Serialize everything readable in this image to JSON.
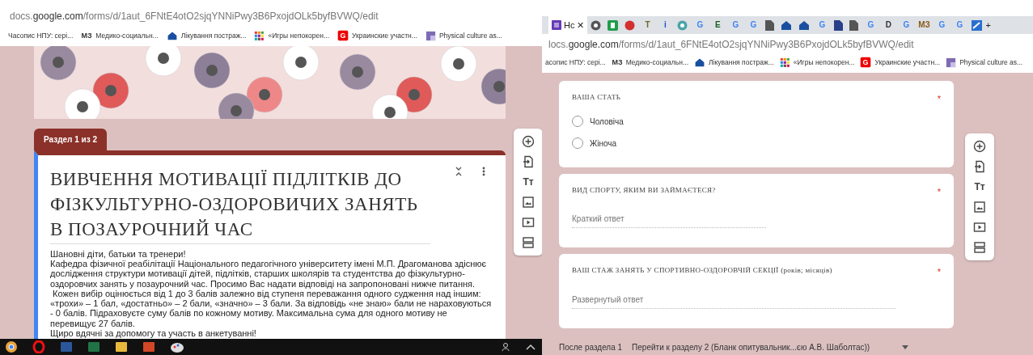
{
  "left_window": {
    "address": {
      "host_prefix": "docs.",
      "host": "google.com",
      "path": "/forms/d/1aut_6FNtE4otO2sjqYNNiPwy3B6PxojdOLk5byfBVWQ/edit"
    },
    "bookmarks": [
      {
        "label": "Часопис НПУ: серi...",
        "kind": "none"
      },
      {
        "label": "Медико-социальн...",
        "kind": "mz",
        "glyph": "МЗ"
      },
      {
        "label": "Лікування постраж...",
        "kind": "house"
      },
      {
        "label": "«Игры непокорен...",
        "kind": "grid"
      },
      {
        "label": "Украинские участн...",
        "kind": "letter",
        "glyph": "G"
      },
      {
        "label": "Physical culture as...",
        "kind": "tile"
      }
    ],
    "section_tab": "Раздел 1 из 2",
    "form_title": "ВИВЧЕННЯ МОТИВАЦІЇ ПІДЛІТКІВ ДО ФІЗКУЛЬТУРНО-ОЗДОРОВИЧИХ ЗАНЯТЬ В ПОЗАУРОЧНИЙ ЧАС",
    "description": [
      "Шановні діти, батьки та тренери!",
      "Кафедра фізичної реабілітації Національного педагогічного університету імені М.П. Драгоманова здіснює дослідження структури мотивації дітей, підлітків, старших школярів та студентства до фізкультурно-оздоровчих занять у позаурочний час. Просимо Вас надати відповіді на запропоновані нижче питання.",
      " Кожен вибір оцінюється від 1 до 3 балів залежно від ступеня переважання одного судження над іншим: «трохи» – 1 бал, «достатньо» – 2 бали, «значно» – 3 бали. За відповідь «не знаю» бали не нараховуються - 0 балів. Підраховуєте суму балів по кожному мотиву. Максимальна сума для одного мотиву не перевищує 27 балів.",
      "Щиро вдячні за допомогу та участь в анкетуванні!"
    ],
    "toolbar_title_glyph": "Tт"
  },
  "right_window": {
    "tabs": [
      {
        "kind": "form",
        "label": "Нс",
        "close": "✕",
        "selected": true
      },
      {
        "kind": "circle",
        "color": "#555555",
        "selected": false
      },
      {
        "kind": "square",
        "color": "#1e9e4a",
        "selected": false
      },
      {
        "kind": "dot",
        "color": "#d32f2f",
        "selected": false
      },
      {
        "kind": "letter",
        "glyph": "T",
        "color": "#6b6b2a",
        "selected": false
      },
      {
        "kind": "letter",
        "glyph": "i",
        "color": "#1a56c4",
        "selected": false
      },
      {
        "kind": "circle",
        "color": "#4aa3a8",
        "selected": false
      },
      {
        "kind": "letter",
        "glyph": "G",
        "color": "#4285f4",
        "selected": false
      },
      {
        "kind": "letter",
        "glyph": "E",
        "color": "#1b5e20",
        "selected": false
      },
      {
        "kind": "letter",
        "glyph": "G",
        "color": "#4285f4",
        "selected": false
      },
      {
        "kind": "letter",
        "glyph": "G",
        "color": "#4285f4",
        "selected": false
      },
      {
        "kind": "doc",
        "color": "#555555",
        "selected": false
      },
      {
        "kind": "house",
        "color": "#1a4fa0",
        "selected": false
      },
      {
        "kind": "house",
        "color": "#1a4fa0",
        "selected": false
      },
      {
        "kind": "letter",
        "glyph": "G",
        "color": "#4285f4",
        "selected": false
      },
      {
        "kind": "doc",
        "color": "#2a3f8a",
        "selected": false
      },
      {
        "kind": "doc",
        "color": "#555555",
        "selected": false
      },
      {
        "kind": "letter",
        "glyph": "G",
        "color": "#4285f4",
        "selected": false
      },
      {
        "kind": "letter",
        "glyph": "D",
        "color": "#333333",
        "selected": false
      },
      {
        "kind": "letter",
        "glyph": "G",
        "color": "#4285f4",
        "selected": false
      },
      {
        "kind": "letter",
        "glyph": "МЗ",
        "color": "#8a5a1a",
        "selected": false
      },
      {
        "kind": "letter",
        "glyph": "G",
        "color": "#4285f4",
        "selected": false
      },
      {
        "kind": "letter",
        "glyph": "G",
        "color": "#4285f4",
        "selected": false
      },
      {
        "kind": "tile",
        "color": "#2a6fd0",
        "selected": false
      }
    ],
    "new_tab": "+",
    "address": {
      "host_prefix": "locs.",
      "host": "google.com",
      "path": "/forms/d/1aut_6FNtE4otO2sjqYNNiPwy3B6PxojdOLk5byfBVWQ/edit"
    },
    "bookmarks": [
      {
        "label": "асопис НПУ: серi...",
        "kind": "none"
      },
      {
        "label": "Медико-социальн...",
        "kind": "mz",
        "glyph": "МЗ"
      },
      {
        "label": "Лікування постраж...",
        "kind": "house"
      },
      {
        "label": "«Игры непокорен...",
        "kind": "grid"
      },
      {
        "label": "Украинские участн...",
        "kind": "letter",
        "glyph": "G"
      },
      {
        "label": "Physical culture as...",
        "kind": "tile"
      }
    ],
    "questions": [
      {
        "kind": "radio",
        "title": "ВАША СТАТЬ",
        "required_mark": "*",
        "options": [
          {
            "label": "Чоловіча",
            "selected": false
          },
          {
            "label": "Жіноча",
            "selected": false
          }
        ]
      },
      {
        "kind": "short",
        "title": "ВИД СПОРТУ, ЯКИМ ВИ ЗАЙМАЄТЕСЯ?",
        "required_mark": "*",
        "placeholder": "Краткий ответ"
      },
      {
        "kind": "paragraph",
        "title": "ВАШ СТАЖ ЗАНЯТЬ У СПОРТИВНО-ОЗДОРОВЧІЙ СЕКЦІЇ (років; місяців)",
        "required_mark": "*",
        "placeholder": "Развернутый ответ"
      }
    ],
    "after_section": {
      "label": "После раздела 1",
      "value": "Перейти к разделу 2 (Бланк опитувальник...єю А.В. Шаболтас))"
    },
    "toolbar_title_glyph": "Tт"
  }
}
